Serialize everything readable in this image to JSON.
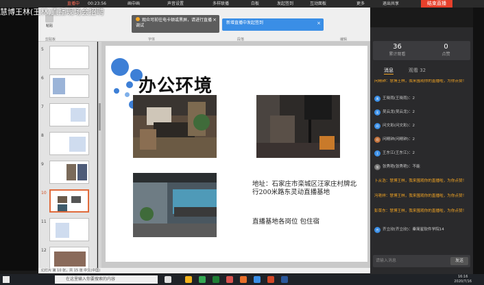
{
  "liveBar": {
    "live_label": "直播中",
    "timer": "00:23:56",
    "items": [
      "画中画",
      "声音设置",
      "多样联播",
      "白板",
      "发起签到",
      "互动面板",
      "更多"
    ],
    "exit_share": "退出共享",
    "end_button": "结束直播"
  },
  "overlay_title": "慧博王林(王林)直播现场会招聘",
  "notices": {
    "one": "观众可前往电卡顿或黑屏，请进行直播调试",
    "two": "新增直播中发起签到"
  },
  "ribbon": {
    "paste": "粘贴",
    "groups": [
      "剪贴板",
      "字体",
      "段落",
      "编辑"
    ]
  },
  "thumbnails": [
    {
      "num": "5"
    },
    {
      "num": "6"
    },
    {
      "num": "7"
    },
    {
      "num": "8"
    },
    {
      "num": "9"
    },
    {
      "num": "10"
    },
    {
      "num": "11"
    },
    {
      "num": "12"
    }
  ],
  "slide": {
    "title": "办公环境",
    "address": "地址：石家庄市栾城区汪家庄村牌北行200米路东灵动直播基地",
    "note": "直播基地各岗位 包住宿"
  },
  "status": "幻灯片 第 10 张，共 15 张  中文(中国)",
  "panel": {
    "stats": [
      {
        "value": "36",
        "label": "累计观看"
      },
      {
        "value": "0",
        "label": "点赞"
      }
    ],
    "tabs": {
      "messages": "消息",
      "invite": "观看 32"
    },
    "messages": [
      {
        "type": "sys",
        "text": "问精钟：慧博王林，我来围观你的直播啦，为你点赞！"
      },
      {
        "type": "user",
        "avatar": "周",
        "text": "王晓雨(王晓雨)：2"
      },
      {
        "type": "user",
        "avatar": "吴",
        "text": "吴云龙(吴云龙)：2"
      },
      {
        "type": "user",
        "avatar": "问",
        "text": "问文彩(问文彩)：2"
      },
      {
        "type": "user",
        "avatar": "问",
        "text": "问精钟(问精钟)：2"
      },
      {
        "type": "user",
        "avatar": "王",
        "text": "王东江(王东江)：2"
      },
      {
        "type": "user",
        "avatar": "张",
        "text": "张秀艳(张秀艳)：不能"
      },
      {
        "type": "sys",
        "text": "卜从浩：慧博王林，我来围观你的直播啦，为你点赞！"
      },
      {
        "type": "sys",
        "text": "冯艳祥：慧博王林，我来围观你的直播啦，为你点赞！"
      },
      {
        "type": "sys",
        "text": "彭菜东：慧博王林，我来围观你的直播啦，为你点赞！"
      },
      {
        "type": "user",
        "avatar": "齐",
        "text": "齐立欣(齐立欣)：秦简星软件学院14"
      }
    ],
    "input_placeholder": "请输入消息",
    "send": "发送"
  },
  "taskbar": {
    "search_placeholder": "在这里输入你要搜索的内容",
    "time": "16:16",
    "date": "2020/7/16"
  }
}
